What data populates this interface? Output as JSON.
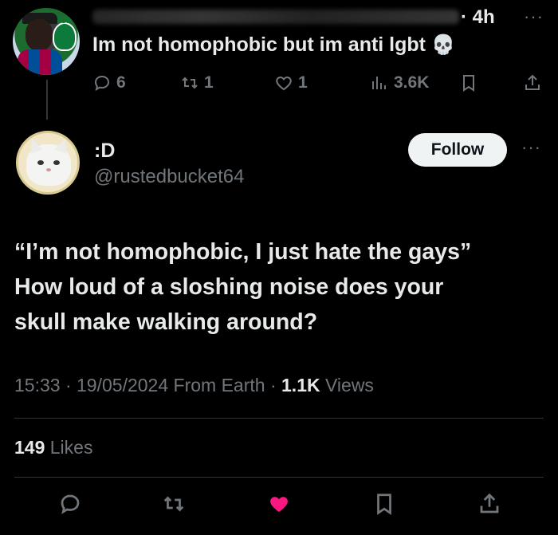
{
  "parent_tweet": {
    "time": "· 4h",
    "more": "···",
    "text": "Im not homophobic but im anti lgbt",
    "emoji": "💀",
    "avatar_badge": "SCP",
    "replies": "6",
    "reposts": "1",
    "likes": "1",
    "views": "3.6K"
  },
  "main_tweet": {
    "display_name": ":D",
    "handle": "@rustedbucket64",
    "follow_label": "Follow",
    "more": "···",
    "body_lines": [
      "“I’m not homophobic, I just hate the gays”",
      "How loud of a sloshing noise does your",
      "skull make walking around?"
    ],
    "time": "15:33",
    "date": "19/05/2024",
    "source": "From Earth",
    "views_count": "1.1K",
    "views_label": "Views",
    "likes_count": "149",
    "likes_label": "Likes",
    "liked": true,
    "like_color": "#f91880"
  },
  "icons": [
    "reply-icon",
    "repost-icon",
    "like-icon",
    "views-icon",
    "bookmark-icon",
    "share-icon"
  ]
}
